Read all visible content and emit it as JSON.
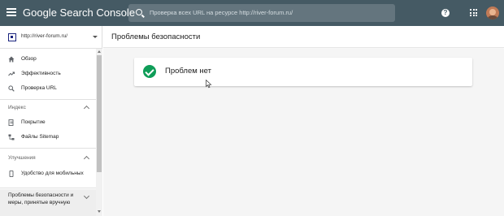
{
  "app": {
    "logo_google": "Google",
    "logo_product": "Search Console"
  },
  "search": {
    "placeholder": "Проверка всех URL на ресурсе http://river-forum.ru/"
  },
  "header_icons": {
    "help": "help-icon",
    "apps": "apps-icon",
    "avatar": "avatar"
  },
  "sidebar": {
    "property": "http://river-forum.ru/",
    "items": [
      {
        "label": "Обзор",
        "icon": "home-icon"
      },
      {
        "label": "Эффективность",
        "icon": "trending-icon"
      },
      {
        "label": "Проверка URL",
        "icon": "search-icon"
      }
    ],
    "sections": [
      {
        "label": "Индекс",
        "items": [
          {
            "label": "Покрытие",
            "icon": "coverage-icon"
          },
          {
            "label": "Файлы Sitemap",
            "icon": "sitemap-icon"
          }
        ]
      },
      {
        "label": "Улучшения",
        "items": [
          {
            "label": "Удобство для мобильных",
            "icon": "mobile-icon"
          }
        ]
      }
    ],
    "active_section": "Проблемы безопасности и меры, принятые вручную"
  },
  "main": {
    "title": "Проблемы безопасности",
    "status_text": "Проблем нет"
  },
  "colors": {
    "topbar": "#455a64",
    "success": "#0f9d58",
    "main_bg": "#f5f5f5"
  }
}
